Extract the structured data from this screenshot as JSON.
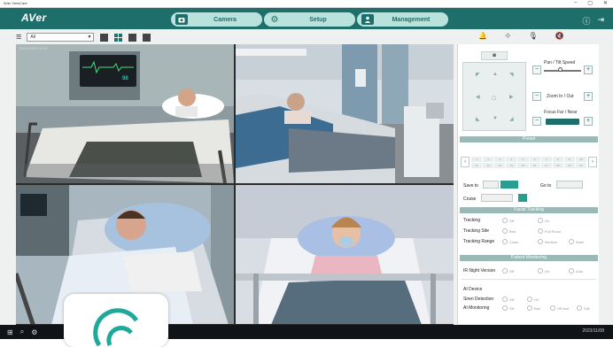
{
  "window": {
    "title": "AVer ViewCare",
    "controls": [
      "–",
      "▢",
      "✕"
    ]
  },
  "header": {
    "logo": "AVer",
    "tabs": [
      {
        "label": "Camera",
        "icon": "camera-icon",
        "active": true
      },
      {
        "label": "Setup",
        "icon": "gear-icon",
        "active": false
      },
      {
        "label": "Management",
        "icon": "user-icon",
        "active": false
      }
    ],
    "right_icons": [
      "info-icon",
      "logout-icon"
    ]
  },
  "toolbar": {
    "layout_value": "All",
    "right_icons": [
      "alarm-icon",
      "tracking-icon",
      "microphone-muted-icon",
      "speaker-muted-icon"
    ]
  },
  "video": {
    "timestamp": "2023/11/08 14:29"
  },
  "panel": {
    "pan_tilt_label": "Pan / Tilt Speed",
    "zoom_label": "Zoom In / Out",
    "focus_label": "Focus Far / Near",
    "preset_header": "Preset",
    "preset_cells": [
      "1",
      "2",
      "3",
      "4",
      "5",
      "6",
      "7",
      "8",
      "9",
      "10",
      "11",
      "12",
      "13",
      "14",
      "15",
      "16",
      "17",
      "18",
      "19",
      "20"
    ],
    "save_to_label": "Save to",
    "go_to_label": "Go to",
    "cruise_label": "Cruise",
    "facial_tracking_header": "Facial Tracking",
    "tracking_label": "Tracking",
    "tracking_options": [
      "Off",
      "On"
    ],
    "tracking_site_label": "Tracking Site",
    "tracking_site_options": [
      "Bed",
      "Full Room"
    ],
    "tracking_range_label": "Tracking Range",
    "tracking_range_options": [
      "Close",
      "Medium",
      "Wide"
    ],
    "patient_monitoring_header": "Patient Monitoring",
    "ir_label": "IR Night Version",
    "ir_options": [
      "Off",
      "On",
      "Auto"
    ],
    "ai_device_label": "AI Device",
    "siren_label": "Siren Detection",
    "siren_options": [
      "Off",
      "On"
    ],
    "ai_monitoring_label": "AI Monitoring",
    "ai_monitoring_options": [
      "Off",
      "Bed",
      "Off-bed",
      "Fall"
    ]
  },
  "taskbar": {
    "time": "2023/11/08"
  },
  "colors": {
    "brand": "#1e6f6c",
    "tab_bg": "#b8e2db",
    "section_header": "#9bb9b6"
  }
}
